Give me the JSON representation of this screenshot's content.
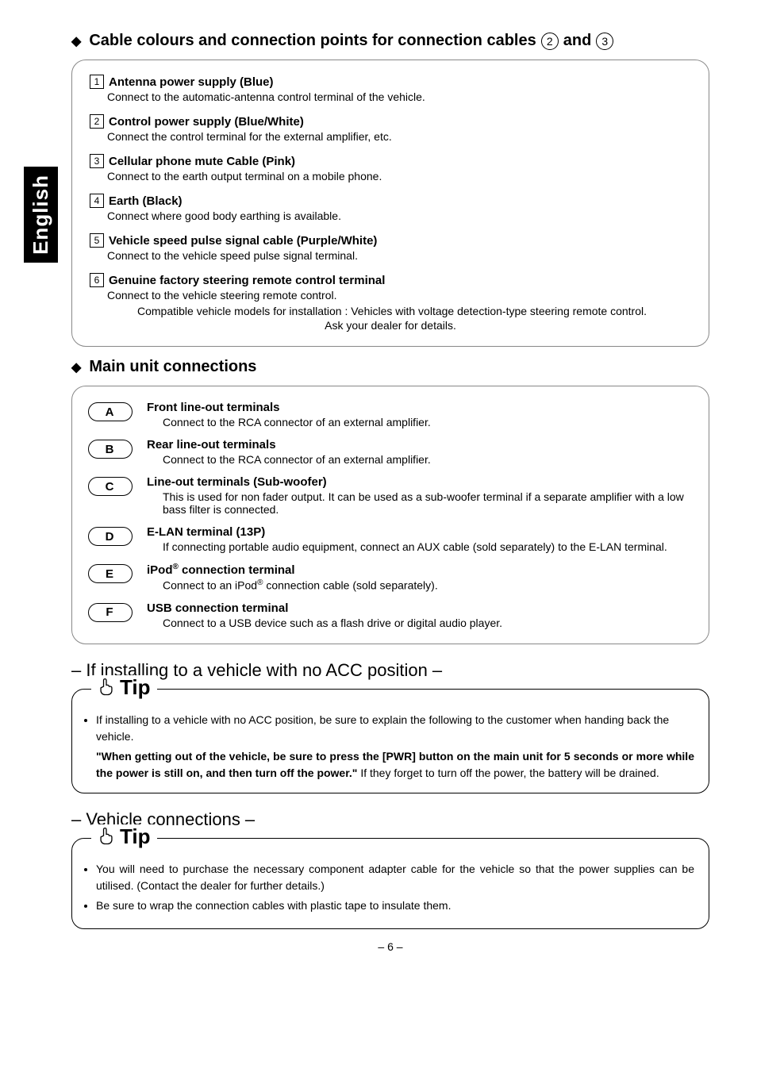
{
  "sideTab": "English",
  "pageNumber": "– 6 –",
  "section1": {
    "titlePrefix": "Cable colours and connection points for connection cables",
    "titleSuffix": "and",
    "circ1": "2",
    "circ2": "3",
    "items": [
      {
        "num": "1",
        "title": "Antenna power supply (Blue)",
        "desc": "Connect to the automatic-antenna control terminal of the vehicle."
      },
      {
        "num": "2",
        "title": "Control power supply (Blue/White)",
        "desc": "Connect the control terminal for the external amplifier, etc."
      },
      {
        "num": "3",
        "title": "Cellular phone mute Cable (Pink)",
        "desc": "Connect to the earth output terminal on a mobile phone."
      },
      {
        "num": "4",
        "title": "Earth (Black)",
        "desc": "Connect where good body earthing is available."
      },
      {
        "num": "5",
        "title": "Vehicle speed pulse signal cable (Purple/White)",
        "desc": "Connect to the vehicle speed pulse signal terminal."
      },
      {
        "num": "6",
        "title": "Genuine factory steering remote control terminal",
        "desc": "Connect to the vehicle steering remote control."
      }
    ],
    "compatLine1": "Compatible vehicle models for installation : Vehicles with voltage detection-type steering remote control.",
    "compatLine2": "Ask your dealer for details."
  },
  "section2": {
    "title": "Main unit connections",
    "items": [
      {
        "letter": "A",
        "title": "Front line-out terminals",
        "desc": "Connect to the RCA connector of an external amplifier."
      },
      {
        "letter": "B",
        "title": "Rear line-out terminals",
        "desc": "Connect to the RCA connector of an external amplifier."
      },
      {
        "letter": "C",
        "title": "Line-out terminals (Sub-woofer)",
        "desc": "This is used for non fader output. It can be used as a sub-woofer terminal if a separate amplifier with a low bass filter is connected."
      },
      {
        "letter": "D",
        "title": "E-LAN terminal (13P)",
        "desc": "If connecting portable audio equipment, connect an AUX cable (sold separately) to the E-LAN terminal."
      },
      {
        "letter": "E",
        "title": "iPod® connection terminal",
        "desc": "Connect to an iPod® connection cable (sold separately)."
      },
      {
        "letter": "F",
        "title": "USB connection terminal",
        "desc": "Connect to a USB device such as a flash drive or digital audio player."
      }
    ]
  },
  "sub1": {
    "heading": "– If installing to a vehicle with no ACC position –",
    "tipLabel": "Tip",
    "bullet1": "If installing to a vehicle with no ACC position, be sure to explain the following to the customer when handing back the vehicle.",
    "boldPart": "\"When getting out of the vehicle, be sure to press the [PWR] button on the main unit for 5 seconds or more while the power is still on, and then turn off the power.\"",
    "restPart": " If they forget to turn off the power, the battery will be drained."
  },
  "sub2": {
    "heading": "– Vehicle connections –",
    "tipLabel": "Tip",
    "bullet1": "You will need to purchase the necessary component adapter cable for the vehicle so that the power supplies can be utilised. (Contact the dealer for further details.)",
    "bullet2": "Be sure to wrap the connection cables with plastic tape to insulate them."
  }
}
